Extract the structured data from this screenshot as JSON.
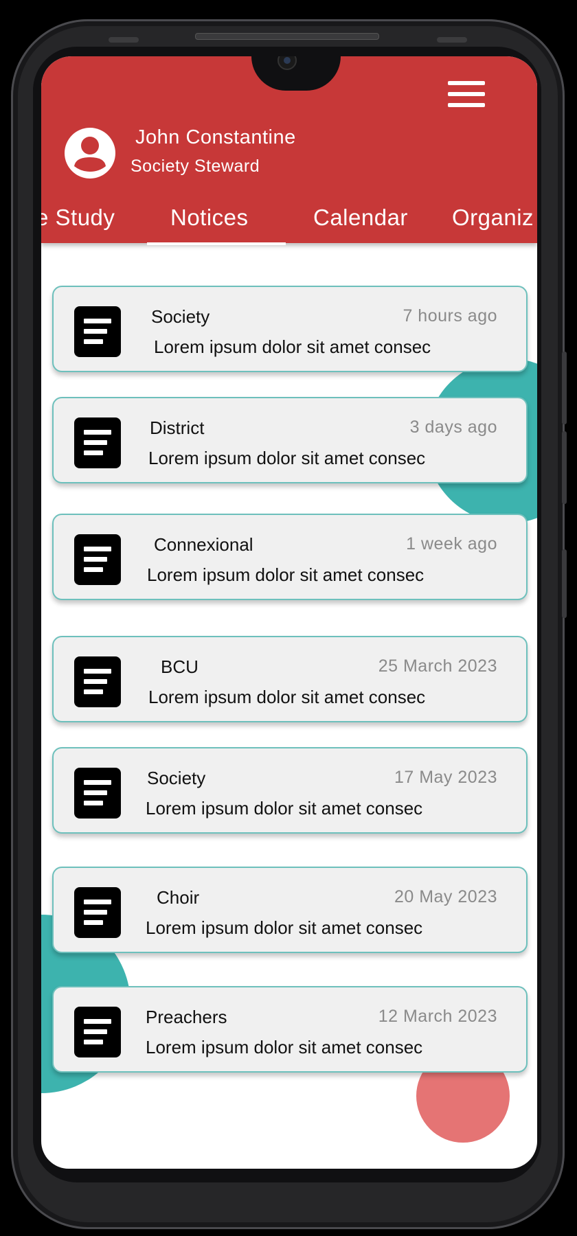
{
  "user": {
    "name": "John Constantine",
    "role": "Society Steward"
  },
  "tabs": [
    {
      "label": "Bible Study",
      "visible": "e Study"
    },
    {
      "label": "Notices",
      "active": true
    },
    {
      "label": "Calendar"
    },
    {
      "label": "Organizations",
      "visible": "Organiz"
    }
  ],
  "notices": [
    {
      "category": "Society",
      "time": "7 hours ago",
      "preview": "Lorem ipsum dolor sit amet consec"
    },
    {
      "category": "District",
      "time": "3 days ago",
      "preview": "Lorem ipsum dolor sit amet consec"
    },
    {
      "category": "Connexional",
      "time": "1 week ago",
      "preview": "Lorem ipsum dolor sit amet consec"
    },
    {
      "category": "BCU",
      "time": "25 March 2023",
      "preview": "Lorem ipsum dolor sit amet consec"
    },
    {
      "category": "Society",
      "time": "17 May 2023",
      "preview": "Lorem ipsum dolor sit amet consec"
    },
    {
      "category": "Choir",
      "time": "20 May 2023",
      "preview": "Lorem ipsum dolor sit amet consec"
    },
    {
      "category": "Preachers",
      "time": "12 March 2023",
      "preview": "Lorem ipsum dolor sit amet consec"
    }
  ],
  "icons": {
    "menu": "hamburger-menu-icon",
    "avatar": "user-avatar-icon",
    "notice": "document-icon"
  },
  "colors": {
    "header": "#c73838",
    "teal_accent": "#3db3ae",
    "coral_accent": "#e57474",
    "card_border": "#6dc0bc"
  }
}
